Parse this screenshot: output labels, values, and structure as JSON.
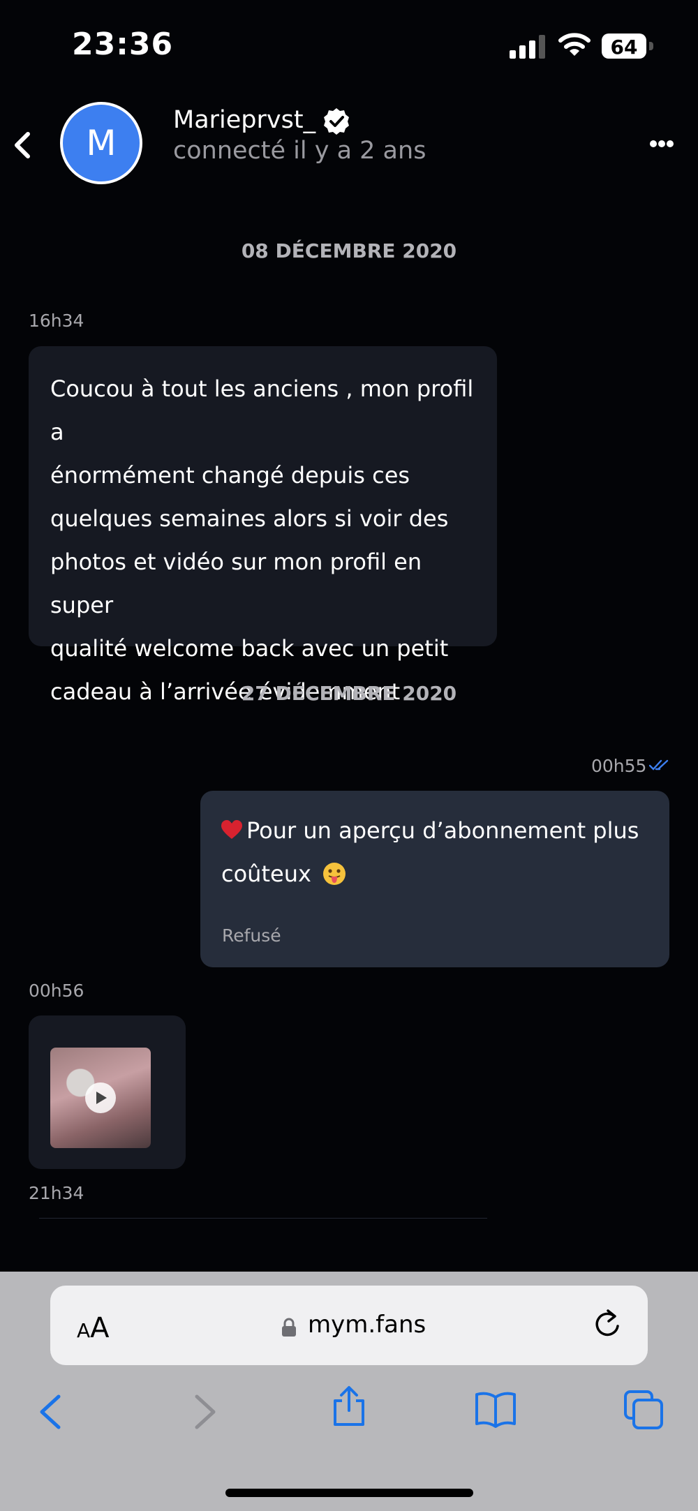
{
  "status_bar": {
    "time": "23:36",
    "battery": "64"
  },
  "header": {
    "avatar_letter": "M",
    "username": "Marieprvst_",
    "status": "connecté il y a 2 ans",
    "accent": "#3d7ff0"
  },
  "chat": {
    "date1": "08 DÉCEMBRE 2020",
    "msg1_time": "16h34",
    "msg1_lines": [
      "Coucou à tout les anciens , mon profil a",
      "énormément changé depuis ces",
      "quelques semaines alors si voir des",
      "photos et vidéo sur mon profil en super",
      "qualité welcome back avec un petit",
      "cadeau à l’arrivée évidemment"
    ],
    "date2": "27 DÉCEMBRE 2020",
    "msg2_time": "00h55",
    "msg2_line1": "Pour un aperçu d’abonnement plus",
    "msg2_line2": "coûteux",
    "msg2_status": "Refusé",
    "msg3_time": "00h56",
    "msg4_time": "21h34"
  },
  "safari": {
    "aa_small": "A",
    "aa_big": "A",
    "url": "mym.fans"
  }
}
